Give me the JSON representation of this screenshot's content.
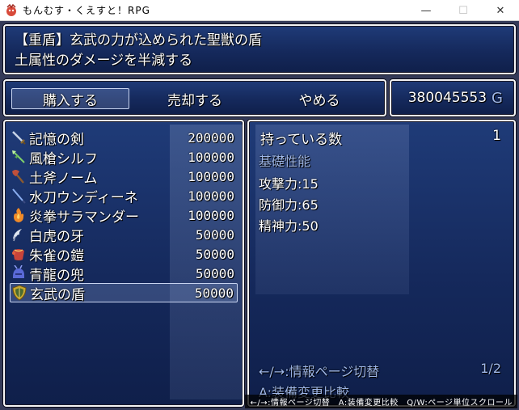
{
  "window": {
    "title": "もんむす・くえすと！RPG",
    "minimize": "—",
    "maximize": "☐",
    "close": "✕"
  },
  "help": {
    "line1": "【重盾】玄武の力が込められた聖獣の盾",
    "line2": "土属性のダメージを半減する"
  },
  "commands": [
    {
      "label": "購入する",
      "selected": true
    },
    {
      "label": "売却する",
      "selected": false
    },
    {
      "label": "やめる",
      "selected": false
    }
  ],
  "gold": {
    "amount": "380045553",
    "unit": "G"
  },
  "items": [
    {
      "name": "記憶の剣",
      "price": "200000",
      "icon": "sword-icon",
      "color": "#b8c4d8"
    },
    {
      "name": "風槍シルフ",
      "price": "100000",
      "icon": "spear-icon",
      "color": "#7fd06a"
    },
    {
      "name": "土斧ノーム",
      "price": "100000",
      "icon": "axe-icon",
      "color": "#c0503a"
    },
    {
      "name": "水刀ウンディーネ",
      "price": "100000",
      "icon": "katana-icon",
      "color": "#6a8fd8"
    },
    {
      "name": "炎拳サラマンダー",
      "price": "100000",
      "icon": "fist-icon",
      "color": "#f08a28"
    },
    {
      "name": "白虎の牙",
      "price": "50000",
      "icon": "fang-icon",
      "color": "#d0d8e8"
    },
    {
      "name": "朱雀の鎧",
      "price": "50000",
      "icon": "armor-icon",
      "color": "#d04a3a"
    },
    {
      "name": "青龍の兜",
      "price": "50000",
      "icon": "helmet-icon",
      "color": "#5a6ad8"
    },
    {
      "name": "玄武の盾",
      "price": "50000",
      "icon": "shield-icon",
      "color": "#c8a830",
      "selected": true
    }
  ],
  "status": {
    "owned_label": "持っている数",
    "owned_value": "1",
    "basic_label": "基礎性能",
    "stats": [
      {
        "label": "攻撃力:15"
      },
      {
        "label": "防御力:65"
      },
      {
        "label": "精神力:50"
      }
    ],
    "page_info": "←/→:情報ページ切替",
    "page_num": "1/2",
    "equip_compare": "A:装備変更比較"
  },
  "hint": "←/→:情報ページ切替　A:装備変更比較　Q/W:ページ単位スクロール"
}
